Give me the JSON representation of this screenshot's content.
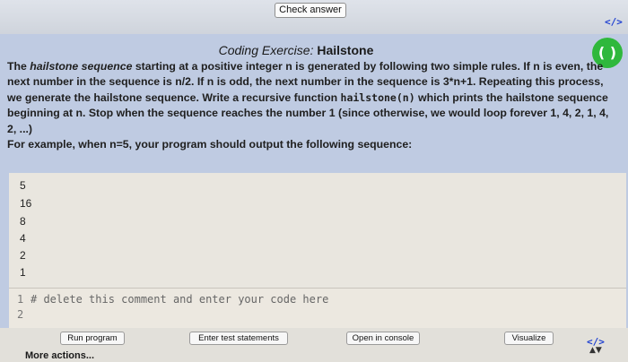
{
  "toolbar": {
    "check_answer_label": "Check answer",
    "code_icon": "</>"
  },
  "exercise": {
    "title_lead": "Coding Exercise:",
    "title_name": "Hailstone",
    "status_icon": "( )",
    "description": {
      "p1": "The ",
      "term": "hailstone sequence",
      "p2": " starting at a positive integer n is generated by following two simple rules. If n is even, the next number in the sequence is n/2. If n is odd, the next number in the sequence is 3*n+1. Repeating this process, we generate the hailstone sequence. Write a recursive function ",
      "func": "hailstone(n)",
      "p3": " which prints the hailstone sequence beginning at n. Stop when the sequence reaches the number 1 (since otherwise, we would loop forever 1, 4, 2, 1, 4, 2, ...)",
      "example": "For example, when n=5, your program should output the following sequence:"
    },
    "sample_output": [
      "5",
      "16",
      "8",
      "4",
      "2",
      "1"
    ]
  },
  "editor": {
    "line_numbers": [
      "1",
      "2"
    ],
    "lines": [
      "# delete this comment and enter your code here",
      ""
    ]
  },
  "actions": {
    "run_program": "Run program",
    "enter_test_statements": "Enter test statements",
    "open_in_console": "Open in console",
    "visualize": "Visualize",
    "code_icon": "</>",
    "more_actions": "More actions...",
    "sort_icon": "▲▼"
  }
}
